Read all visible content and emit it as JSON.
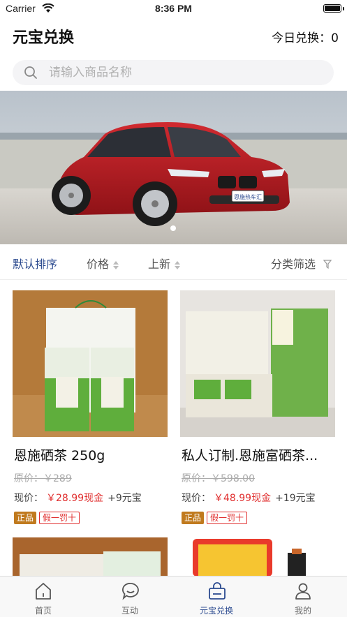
{
  "status_bar": {
    "carrier": "Carrier",
    "time": "8:36 PM"
  },
  "header": {
    "title": "元宝兑换",
    "today_label": "今日兑换：",
    "today_count": "0"
  },
  "search": {
    "placeholder": "请输入商品名称"
  },
  "banner": {
    "plate_text": "恩施热车汇",
    "current_slide": 1
  },
  "sort_bar": {
    "options": [
      "默认排序",
      "价格",
      "上新"
    ],
    "filter_label": "分类筛选"
  },
  "products": [
    {
      "name": "恩施硒茶  250g",
      "orig_label": "原价：",
      "orig_price": "￥289",
      "price_label": "现价：",
      "cash": "￥28.99现金",
      "coins": "+9元宝",
      "tag_primary": "正品",
      "tag_secondary": "假一罚十"
    },
    {
      "name": "私人订制.恩施富硒茶...",
      "orig_label": "原价：",
      "orig_price": "￥598.00",
      "price_label": "现价：",
      "cash": "￥48.99现金",
      "coins": "+19元宝",
      "tag_primary": "正品",
      "tag_secondary": "假一罚十"
    }
  ],
  "tab_bar": {
    "items": [
      "首页",
      "互动",
      "元宝兑换",
      "我的"
    ],
    "active_index": 2
  },
  "colors": {
    "accent": "#2b4a8f",
    "price_red": "#e02f2f",
    "tag_gold": "#c07a1e"
  },
  "icons": [
    "wifi-icon",
    "battery-icon",
    "search-icon",
    "sort-arrows-icon",
    "filter-icon",
    "home-icon",
    "chat-icon",
    "basket-icon",
    "user-icon"
  ]
}
